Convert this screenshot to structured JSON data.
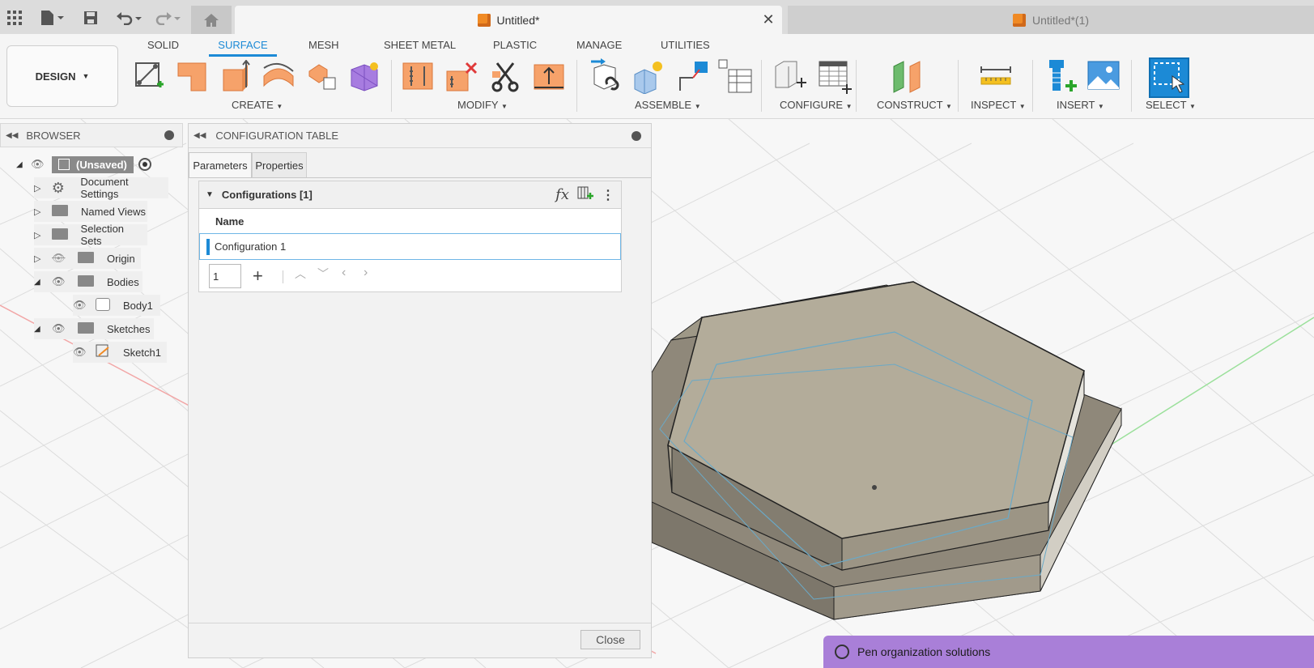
{
  "window": {
    "active_tab": "Untitled*",
    "inactive_tab": "Untitled*(1)"
  },
  "ribbon": {
    "design_label": "DESIGN",
    "tabs": [
      "SOLID",
      "SURFACE",
      "MESH",
      "SHEET METAL",
      "PLASTIC",
      "MANAGE",
      "UTILITIES"
    ],
    "active_tab": "SURFACE",
    "groups": [
      "CREATE",
      "MODIFY",
      "ASSEMBLE",
      "CONFIGURE",
      "CONSTRUCT",
      "INSPECT",
      "INSERT",
      "SELECT"
    ]
  },
  "browser": {
    "title": "BROWSER",
    "items": [
      {
        "label": "(Unsaved)"
      },
      {
        "label": "Document Settings"
      },
      {
        "label": "Named Views"
      },
      {
        "label": "Selection Sets"
      },
      {
        "label": "Origin"
      },
      {
        "label": "Bodies"
      },
      {
        "label": "Body1"
      },
      {
        "label": "Sketches"
      },
      {
        "label": "Sketch1"
      }
    ]
  },
  "config_table": {
    "title": "CONFIGURATION TABLE",
    "tabs": [
      "Parameters",
      "Properties"
    ],
    "section_title": "Configurations [1]",
    "column_header": "Name",
    "rows": [
      "Configuration 1"
    ],
    "row_count_value": "1",
    "close_label": "Close",
    "fx_label": "fx"
  },
  "chat_bar": {
    "text": "Pen organization solutions"
  },
  "colors": {
    "accent": "#1c8ad6",
    "tool_orange": "#f6a26a",
    "chat_purple": "#a97fd8",
    "model_face": "#a8a08f"
  }
}
